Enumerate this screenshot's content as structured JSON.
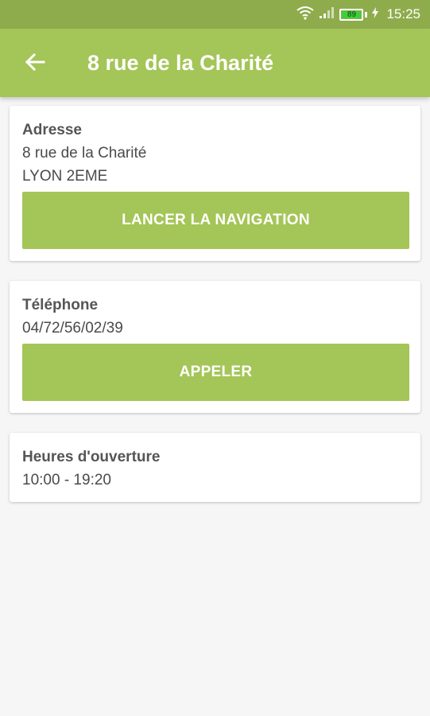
{
  "status_bar": {
    "time": "15:25",
    "battery_level": "89",
    "icons": [
      "wifi-icon",
      "signal-icon",
      "battery-icon",
      "charging-icon"
    ]
  },
  "app_bar": {
    "back_icon": "arrow-left-icon",
    "title": "8 rue de la Charité"
  },
  "address_card": {
    "label": "Adresse",
    "street": "8 rue de la Charité",
    "city": "LYON 2EME",
    "button_label": "LANCER LA NAVIGATION"
  },
  "phone_card": {
    "label": "Téléphone",
    "number": "04/72/56/02/39",
    "button_label": "APPELER"
  },
  "hours_card": {
    "label": "Heures d'ouverture",
    "hours": "10:00 - 19:20"
  },
  "colors": {
    "status_bar": "#8fac4d",
    "primary": "#a4c557",
    "background": "#f6f6f6"
  }
}
